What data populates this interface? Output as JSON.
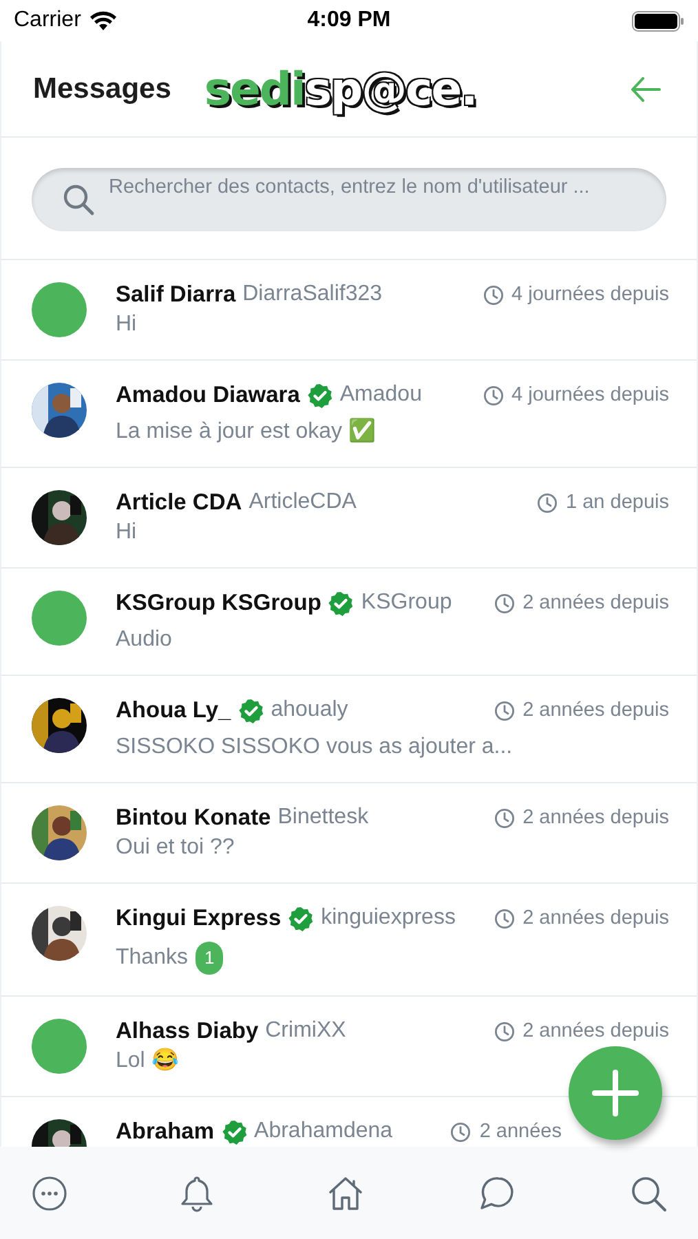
{
  "status_bar": {
    "carrier": "Carrier",
    "time": "4:09 PM"
  },
  "header": {
    "title": "Messages",
    "logo_accent": "sedi",
    "logo_rest": "sp@ce."
  },
  "search": {
    "placeholder": "Rechercher des contacts, entrez le nom d'utilisateur ..."
  },
  "conversations": [
    {
      "name": "Salif Diarra",
      "verified": false,
      "handle": "DiarraSalif323",
      "time": "4 journées depuis",
      "message": "Hi",
      "avatar": {
        "kind": "plain"
      }
    },
    {
      "name": "Amadou Diawara",
      "verified": true,
      "handle": "Amadou",
      "time": "4 journées depuis",
      "message": "La mise à jour est okay ✅"
    },
    {
      "name": "Article CDA",
      "verified": false,
      "handle": "ArticleCDA",
      "time": "1 an depuis",
      "message": "Hi"
    },
    {
      "name": "KSGroup KSGroup",
      "verified": true,
      "handle": "KSGroup",
      "time": "2 années depuis",
      "message": "Audio",
      "avatar": {
        "kind": "plain"
      }
    },
    {
      "name": "Ahoua Ly_",
      "verified": true,
      "handle": "ahoualy",
      "time": "2 années depuis",
      "message": "SISSOKO SISSOKO vous as ajouter a..."
    },
    {
      "name": "Bintou Konate",
      "verified": false,
      "handle": "Binettesk",
      "time": "2 années depuis",
      "message": "Oui et toi ??"
    },
    {
      "name": "Kingui Express",
      "verified": true,
      "handle": "kinguiexpress",
      "time": "2 années depuis",
      "message": "Thanks",
      "unread": "1"
    },
    {
      "name": "Alhass Diaby",
      "verified": false,
      "handle": "CrimiXX",
      "time": "2 années depuis",
      "message": "Lol 😂",
      "avatar": {
        "kind": "plain"
      }
    },
    {
      "name": "Abraham",
      "verified": true,
      "handle": "Abrahamdena",
      "time": "2 années"
    }
  ],
  "fab": {
    "kind": "add"
  },
  "tab_bar": [
    {
      "kind": "more"
    },
    {
      "kind": "bell"
    },
    {
      "kind": "home"
    },
    {
      "kind": "chat"
    },
    {
      "kind": "search"
    }
  ]
}
